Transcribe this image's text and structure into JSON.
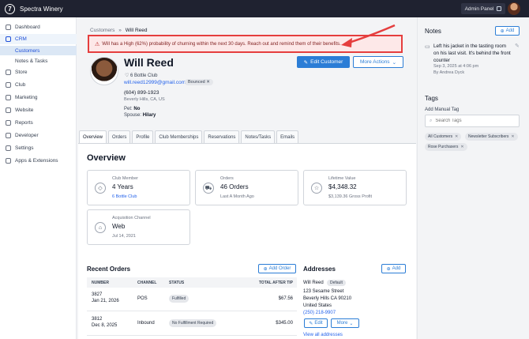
{
  "app": {
    "name": "Spectra Winery",
    "logo_char": "7",
    "admin_panel": "Admin Panel"
  },
  "sidebar": {
    "items": [
      {
        "label": "Dashboard"
      },
      {
        "label": "CRM"
      },
      {
        "label": "Customers"
      },
      {
        "label": "Notes & Tasks"
      },
      {
        "label": "Store"
      },
      {
        "label": "Club"
      },
      {
        "label": "Marketing"
      },
      {
        "label": "Website"
      },
      {
        "label": "Reports"
      },
      {
        "label": "Developer"
      },
      {
        "label": "Settings"
      },
      {
        "label": "Apps & Extensions"
      }
    ]
  },
  "breadcrumb": {
    "parent": "Customers",
    "separator": "»",
    "current": "Will Reed"
  },
  "alert": {
    "text": "Will has a High (62%) probability of churning within the next 30 days. Reach out and remind them of their benefits."
  },
  "customer": {
    "name": "Will Reed",
    "club": "6 Bottle Club",
    "email": "will.reed12999@gmail.com",
    "email_status": "Bounced",
    "phone": "(604) 899-1923",
    "location": "Beverly Hills, CA, US",
    "pet_label": "Pet:",
    "pet": "No",
    "spouse_label": "Spouse:",
    "spouse": "Hilary"
  },
  "actions": {
    "edit": "Edit Customer",
    "more": "More Actions"
  },
  "tabs": [
    "Overview",
    "Orders",
    "Profile",
    "Club Memberships",
    "Reservations",
    "Notes/Tasks",
    "Emails"
  ],
  "overview": {
    "title": "Overview",
    "cards": [
      {
        "label": "Club Member",
        "value": "4 Years",
        "sub": "6 Bottle Club",
        "icon": "diamond-icon"
      },
      {
        "label": "Orders",
        "value": "46 Orders",
        "sub": "Last A Month Ago",
        "icon": "cart-icon"
      },
      {
        "label": "Lifetime Value",
        "value": "$4,348.32",
        "sub": "$3,139.36 Gross Profit",
        "icon": "star-icon"
      },
      {
        "label": "Acquisition Channel",
        "value": "Web",
        "sub": "Jul 14, 2021",
        "icon": "store-icon"
      }
    ]
  },
  "recent_orders": {
    "title": "Recent Orders",
    "add_label": "Add Order",
    "columns": [
      "NUMBER",
      "CHANNEL",
      "STATUS",
      "TOTAL AFTER TIP"
    ],
    "rows": [
      {
        "number": "3827",
        "date": "Jan 21, 2026",
        "channel": "POS",
        "status": "Fulfilled",
        "total": "$67.56"
      },
      {
        "number": "3812",
        "date": "Dec 8, 2025",
        "channel": "Inbound",
        "status": "No Fulfillment Required",
        "total": "$345.00"
      }
    ]
  },
  "addresses": {
    "title": "Addresses",
    "add_label": "Add",
    "name": "Will Reed",
    "default_badge": "Default",
    "street": "123 Sesame Street",
    "city": "Beverly Hills CA 90210",
    "country": "United States",
    "phone": "(250) 218-9907",
    "edit_label": "Edit",
    "more_label": "More",
    "view_all": "View all addresses"
  },
  "notes": {
    "title": "Notes",
    "add_label": "Add",
    "text": "Left his jacket in the tasting room on his last visit. It's behind the front counter",
    "date": "Sep 3, 2025 at 4:06 pm",
    "by": "By Andrea Dyck"
  },
  "tags": {
    "title": "Tags",
    "sub": "Add Manual Tag",
    "search_placeholder": "Search Tags",
    "items": [
      "All Customers",
      "Newsletter Subscribers",
      "Rose Purchasers"
    ]
  },
  "colors": {
    "accent": "#2b7dd6",
    "alert_border": "#e53e3e",
    "topbar": "#1f2230"
  }
}
